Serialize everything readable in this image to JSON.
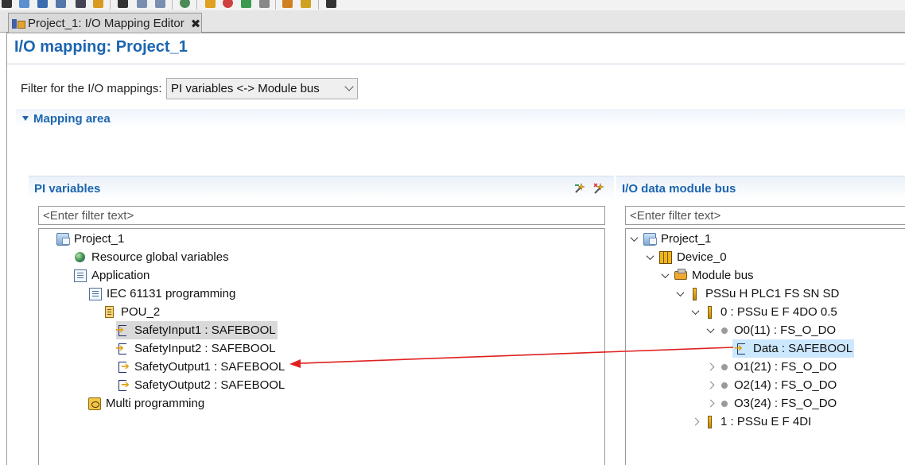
{
  "tab": {
    "title": "Project_1: I/O Mapping Editor",
    "close_glyph": "✖"
  },
  "page": {
    "title": "I/O mapping: Project_1"
  },
  "filter": {
    "label": "Filter for the I/O mappings:",
    "selected": "PI variables <-> Module bus"
  },
  "mapping_area": {
    "title": "Mapping area"
  },
  "left_panel": {
    "title": "PI variables",
    "filter_placeholder": "<Enter filter text>",
    "tree": {
      "project": "Project_1",
      "resource_globals": "Resource global variables",
      "application": "Application",
      "iec": "IEC 61131 programming",
      "pou": "POU_2",
      "var1": "SafetyInput1 : SAFEBOOL",
      "var2": "SafetyInput2 : SAFEBOOL",
      "var3": "SafetyOutput1 : SAFEBOOL",
      "var4": "SafetyOutput2 : SAFEBOOL",
      "multi": "Multi programming"
    }
  },
  "right_panel": {
    "title": "I/O data module bus",
    "filter_placeholder": "<Enter filter text>",
    "tree": {
      "project": "Project_1",
      "device": "Device_0",
      "module_bus": "Module bus",
      "plc": "PSSu H PLC1 FS SN SD",
      "module0": "0 : PSSu E F 4DO 0.5",
      "o0": "O0(11) : FS_O_DO",
      "data": "Data : SAFEBOOL",
      "o1": "O1(21) : FS_O_DO",
      "o2": "O2(14) : FS_O_DO",
      "o3": "O3(24) : FS_O_DO",
      "module1": "1 : PSSu E F 4DI"
    }
  },
  "colors": {
    "accent": "#1b65b0",
    "arrow": "#e02020",
    "selection_blue": "#cce8ff",
    "selection_gray": "#d9d9d9"
  }
}
